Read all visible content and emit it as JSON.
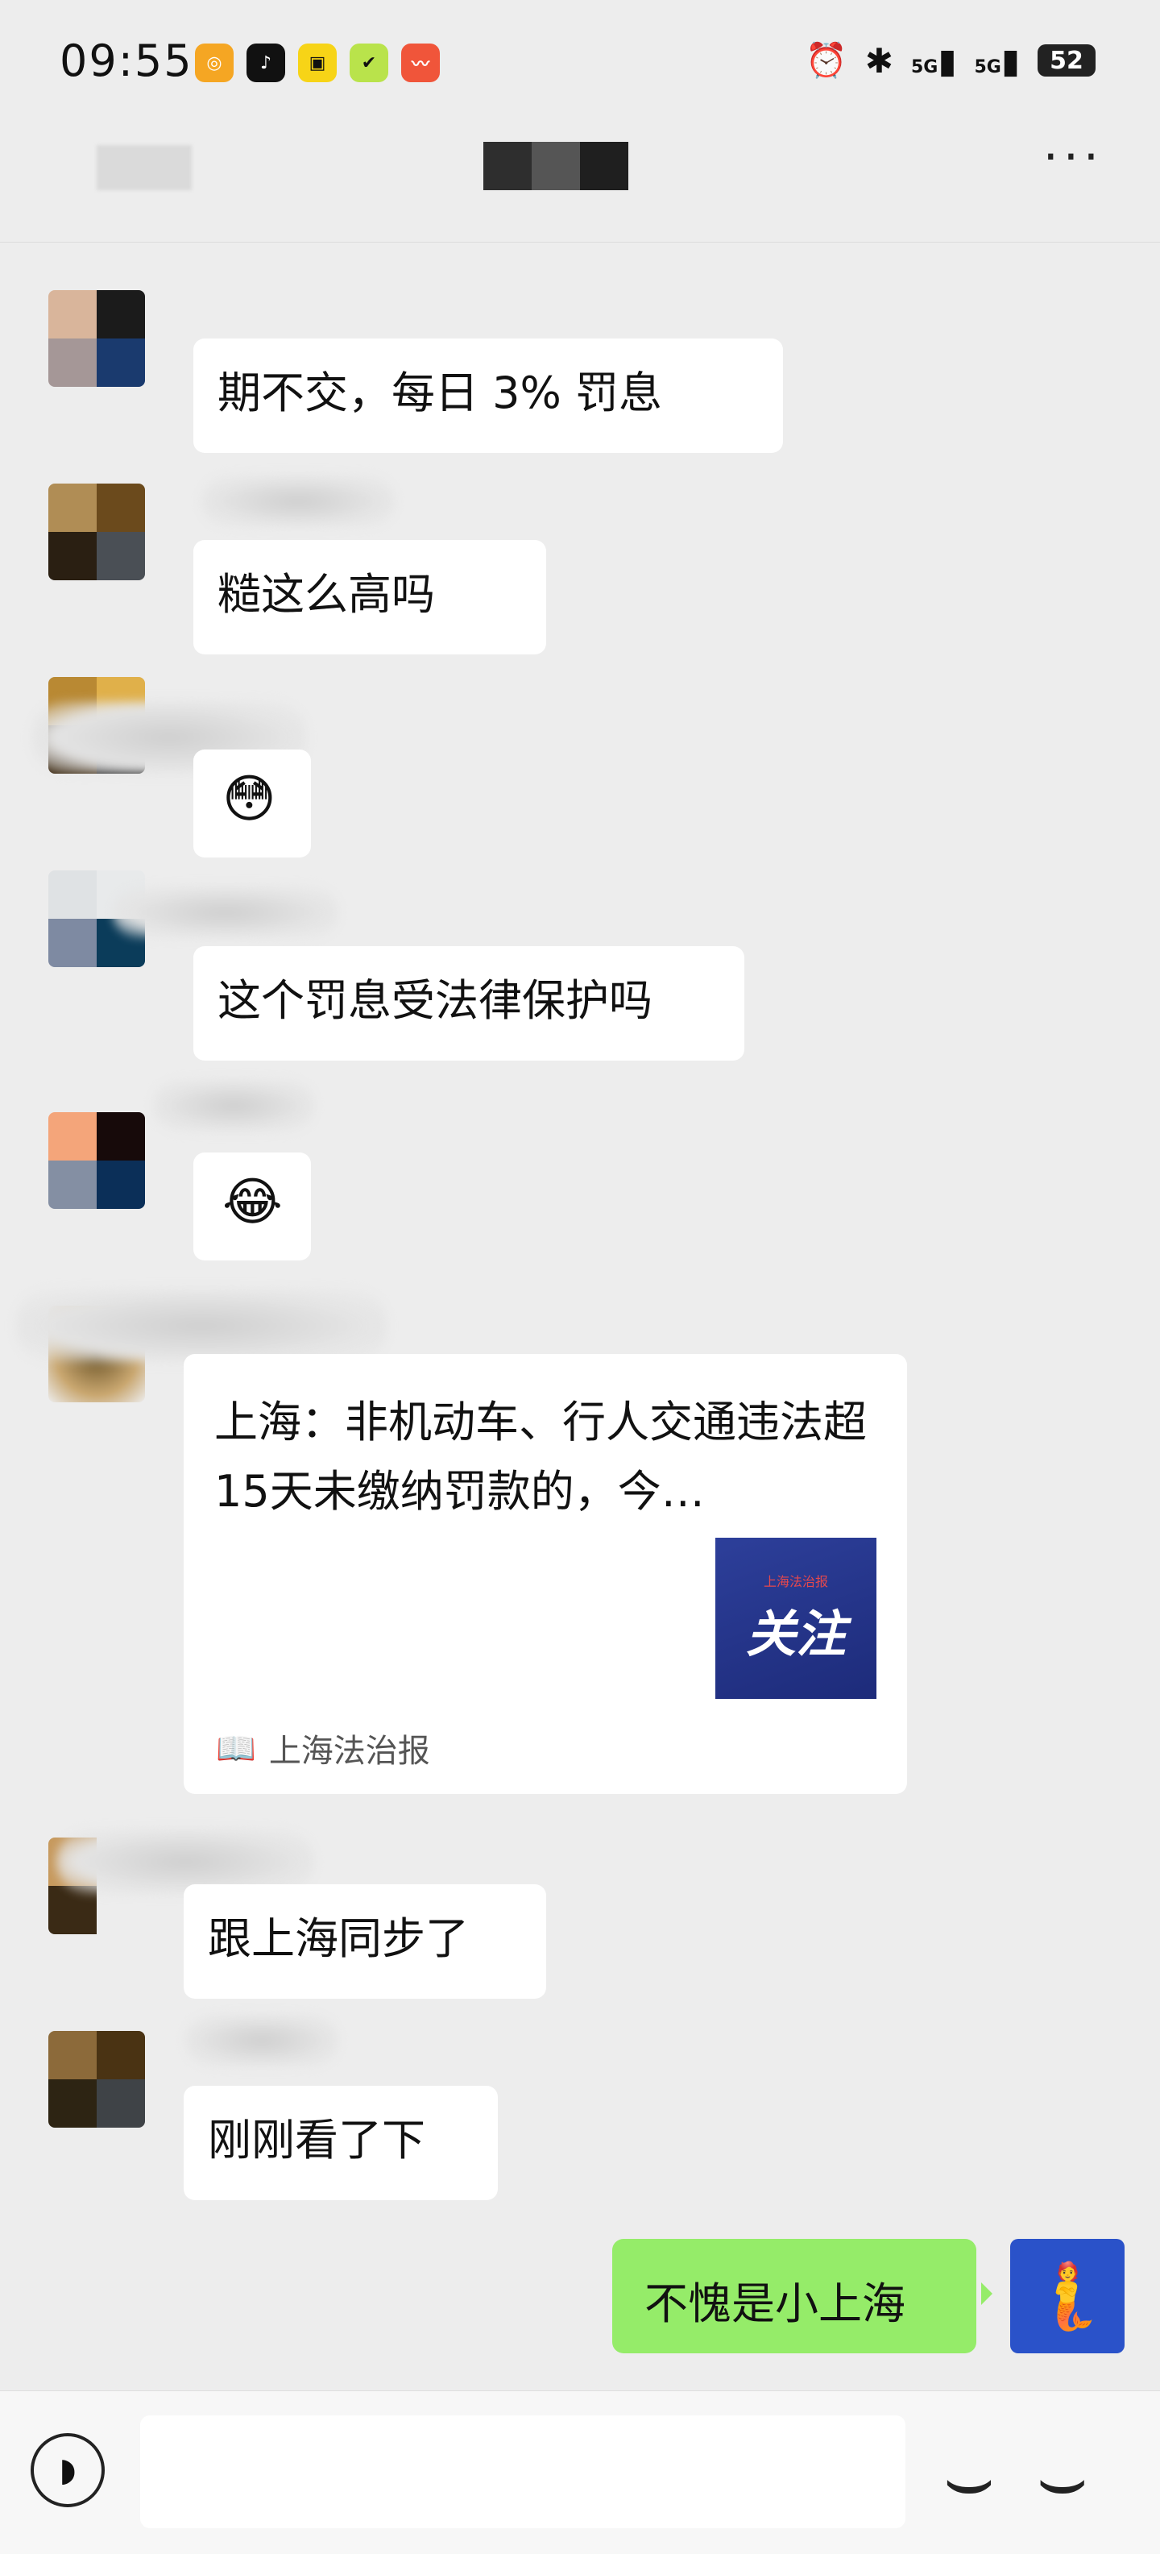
{
  "status_bar": {
    "time": "09:55",
    "app_icons": [
      {
        "name": "app-orange-icon",
        "glyph": "◎",
        "color": "#f5a623"
      },
      {
        "name": "tiktok-icon",
        "glyph": "♪",
        "color": "#111111"
      },
      {
        "name": "app-yellow-icon",
        "glyph": "▣",
        "color": "#f7d417"
      },
      {
        "name": "app-green-icon",
        "glyph": "✔",
        "color": "#b9e34b"
      },
      {
        "name": "app-red-icon",
        "glyph": "〰",
        "color": "#f0553a"
      }
    ],
    "sig_label_1": "5G",
    "sig_label_2": "5G",
    "battery": "52"
  },
  "header": {
    "more_glyph": "···"
  },
  "messages": [
    {
      "text": "期不交，每日 3% 罚息"
    },
    {
      "text": "糙这么高吗"
    },
    {
      "text": "😳"
    },
    {
      "text": "这个罚息受法律保护吗"
    },
    {
      "text": "😂"
    },
    {
      "text": "跟上海同步了"
    },
    {
      "text": "刚刚看了下"
    }
  ],
  "card": {
    "title": "上海：非机动车、行人交通违法超15天未缴纳罚款的，今…",
    "thumb_small": "上海法治报",
    "thumb_big": "关注",
    "source": "上海法治报"
  },
  "self_message": {
    "text": "不愧是小上海"
  },
  "colors": {
    "self_bubble": "#95ec69",
    "background": "#ededed"
  }
}
